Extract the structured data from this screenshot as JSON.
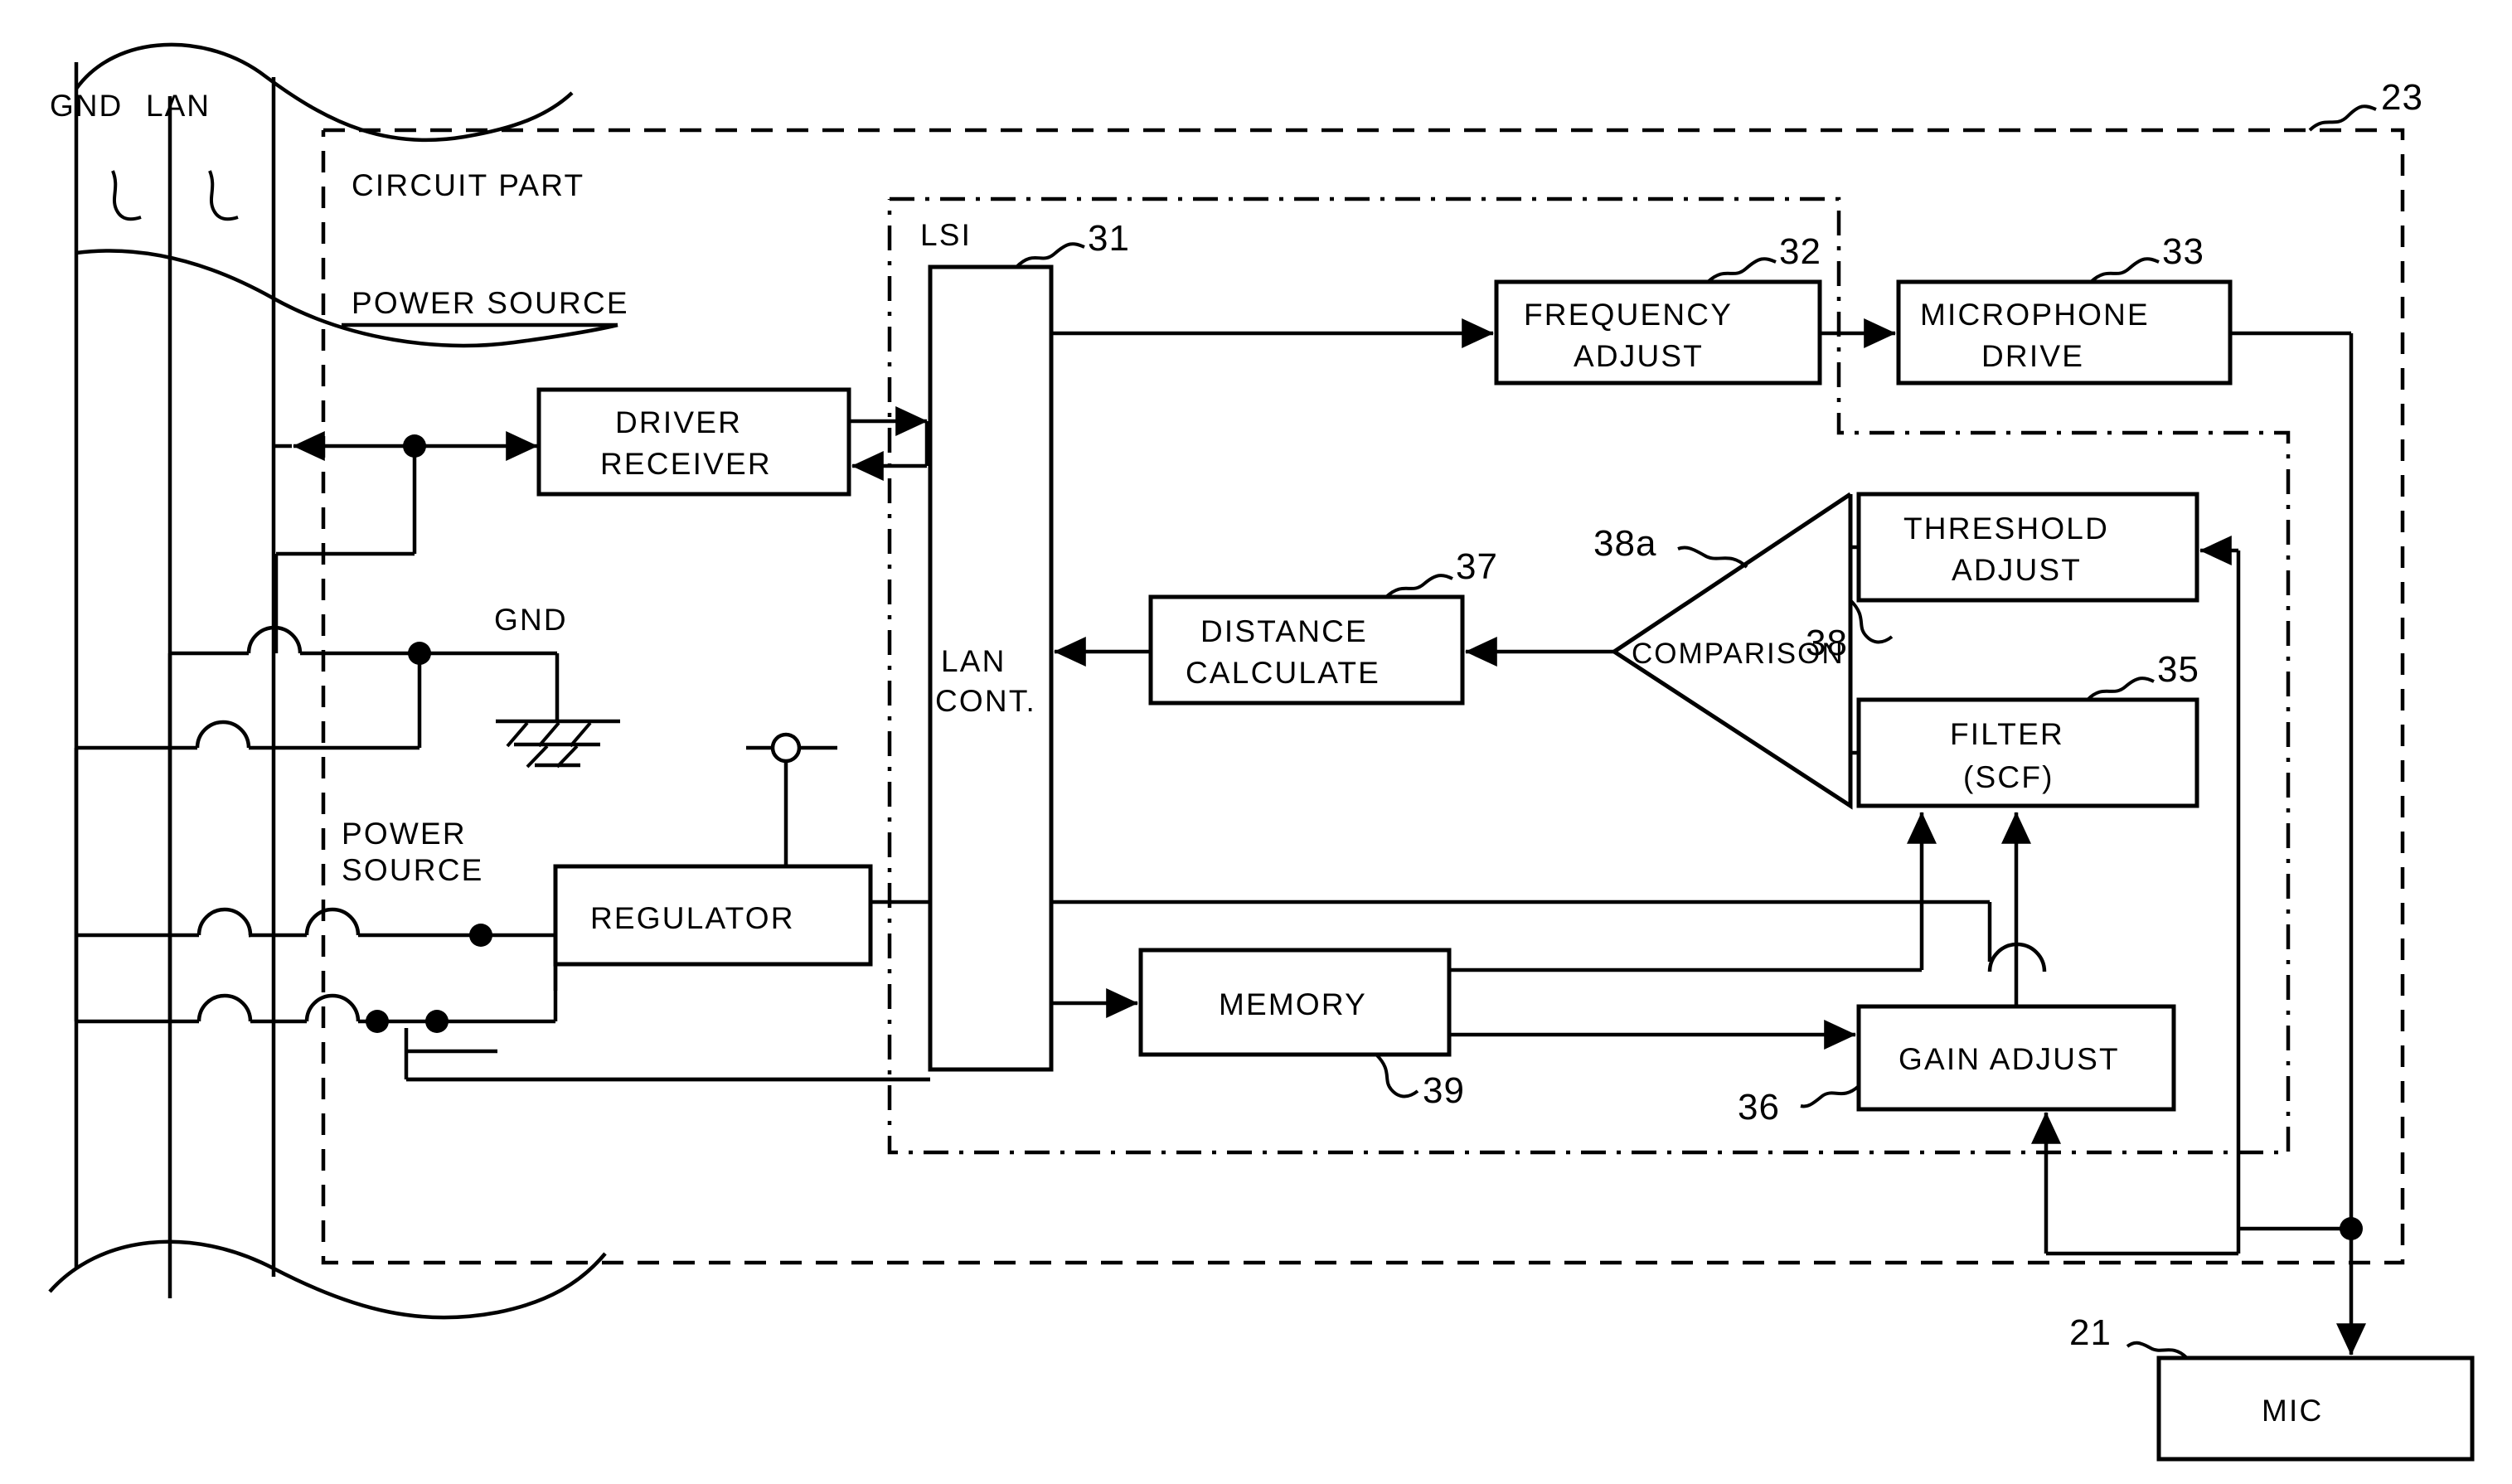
{
  "figure": {
    "type": "patent-block-diagram",
    "outer_boundary_ref": "23",
    "outer_boundary_style": "dashed"
  },
  "cable": {
    "gnd_label": "GND",
    "lan_label": "LAN"
  },
  "regions": [
    {
      "id": "circuit-part",
      "label": "CIRCUIT PART",
      "style": "dashed",
      "ref": "23"
    },
    {
      "id": "lsi",
      "label": "LSI",
      "style": "dash-dot",
      "ref": "31"
    }
  ],
  "inline_labels": {
    "power_source_top": "POWER SOURCE",
    "gnd_mid": "GND",
    "power_source_left_line1": "POWER",
    "power_source_left_line2": "SOURCE"
  },
  "blocks": [
    {
      "id": "lan-cont",
      "label": "LAN\nCONT.",
      "line1": "LAN",
      "line2": "CONT.",
      "ref": "31"
    },
    {
      "id": "driver-receiver",
      "label": "DRIVER RECEIVER",
      "line1": "DRIVER",
      "line2": "RECEIVER",
      "ref": ""
    },
    {
      "id": "frequency-adjust",
      "label": "FREQUENCY ADJUST",
      "line1": "FREQUENCY",
      "line2": "ADJUST",
      "ref": "32"
    },
    {
      "id": "microphone-drive",
      "label": "MICROPHONE DRIVE",
      "line1": "MICROPHONE",
      "line2": "DRIVE",
      "ref": "33"
    },
    {
      "id": "threshold-adjust",
      "label": "THRESHOLD ADJUST",
      "line1": "THRESHOLD",
      "line2": "ADJUST",
      "ref": ""
    },
    {
      "id": "filter-scf",
      "label": "FILTER (SCF)",
      "line1": "FILTER",
      "line2": "(SCF)",
      "ref": "35"
    },
    {
      "id": "distance-calculate",
      "label": "DISTANCE CALCULATE",
      "line1": "DISTANCE",
      "line2": "CALCULATE",
      "ref": "37"
    },
    {
      "id": "comparison",
      "label": "COMPARISON",
      "line1": "COMPARISON",
      "line2": "",
      "ref": "38"
    },
    {
      "id": "regulator",
      "label": "REGULATOR",
      "line1": "REGULATOR",
      "line2": "",
      "ref": ""
    },
    {
      "id": "memory",
      "label": "MEMORY",
      "line1": "MEMORY",
      "line2": "",
      "ref": "39"
    },
    {
      "id": "gain-adjust",
      "label": "GAIN ADJUST",
      "line1": "GAIN ADJUST",
      "line2": "",
      "ref": "36"
    },
    {
      "id": "mic",
      "label": "MIC",
      "line1": "MIC",
      "line2": "",
      "ref": "21"
    }
  ],
  "reference_numerals": {
    "n21": "21",
    "n23": "23",
    "n31": "31",
    "n32": "32",
    "n33": "33",
    "n35": "35",
    "n36": "36",
    "n37": "37",
    "n38": "38",
    "n38a": "38a",
    "n39": "39"
  },
  "colors": {
    "ink": "#000000",
    "paper": "#ffffff"
  }
}
